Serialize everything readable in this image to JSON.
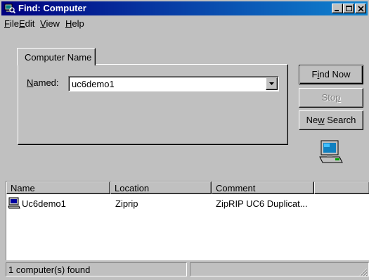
{
  "window": {
    "title": "Find: Computer",
    "title_icon": "computer-search-icon"
  },
  "titlebar_buttons": [
    {
      "name": "minimize",
      "icon": "minimize-icon"
    },
    {
      "name": "maximize",
      "icon": "maximize-icon"
    },
    {
      "name": "close",
      "icon": "close-icon"
    }
  ],
  "menu": {
    "file": {
      "accel": "F",
      "rest": "ile"
    },
    "edit": {
      "accel": "E",
      "rest": "dit"
    },
    "view": {
      "accel": "V",
      "rest": "iew"
    },
    "help": {
      "accel": "H",
      "rest": "elp"
    }
  },
  "tab": {
    "label": "Computer Name"
  },
  "form": {
    "named_accel": "N",
    "named_rest": "amed:",
    "named_value": "uc6demo1"
  },
  "buttons": {
    "find_now": {
      "pre": "F",
      "accel": "i",
      "post": "nd Now"
    },
    "stop": {
      "pre": "Sto",
      "accel": "p",
      "post": ""
    },
    "new_search": {
      "pre": "Ne",
      "accel": "w",
      "post": " Search"
    }
  },
  "results": {
    "columns": [
      "Name",
      "Location",
      "Comment"
    ],
    "rows": [
      {
        "name": "Uc6demo1",
        "location": "Ziprip",
        "comment": "ZipRIP UC6 Duplicat...",
        "icon": "computer-icon"
      }
    ]
  },
  "status": {
    "text": "1 computer(s) found"
  },
  "colors": {
    "titlebar_start": "#000080",
    "titlebar_end": "#1084d0",
    "face": "#c0c0c0"
  }
}
